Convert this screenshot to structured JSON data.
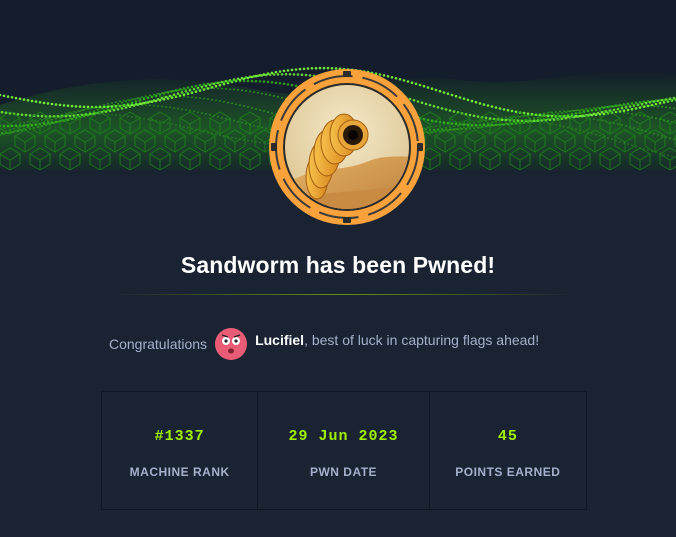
{
  "card": {
    "title": "Sandworm has been Pwned!",
    "congrats_lead": "Congratulations",
    "username": "Lucifiel",
    "congrats_tail": ", best of luck in capturing flags ahead!"
  },
  "stats": [
    {
      "value": "#1337",
      "label": "MACHINE RANK"
    },
    {
      "value": "29 Jun 2023",
      "label": "PWN DATE"
    },
    {
      "value": "45",
      "label": "POINTS EARNED"
    }
  ],
  "colors": {
    "background": "#1a2332",
    "accent_green": "#9fef00",
    "badge_orange": "#f9a23b",
    "muted_text": "#a4b1cd"
  },
  "icons": {
    "machine_badge": "sandworm-badge-icon",
    "user_avatar": "avatar-icon"
  }
}
